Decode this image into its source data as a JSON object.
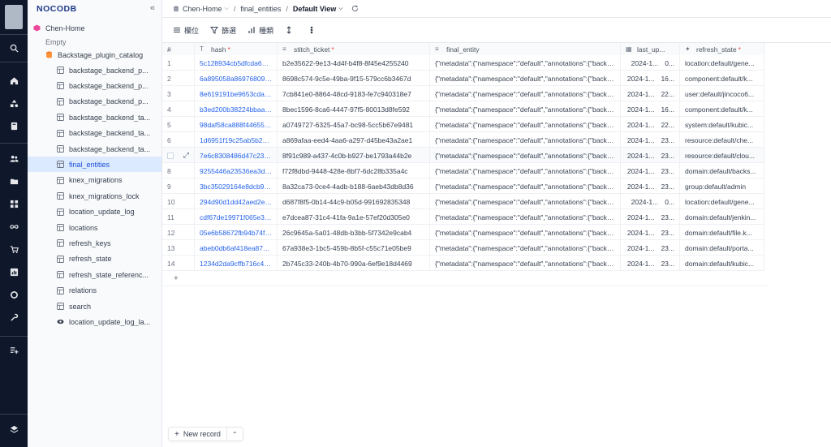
{
  "app": {
    "brand": "NOCODB",
    "collapse_glyph": "«"
  },
  "rail": {
    "icons": [
      "search-icon",
      "home-icon",
      "shapes-icon",
      "book-icon",
      "users-icon",
      "folder-icon",
      "grid-icon",
      "infinity-icon",
      "cart-icon",
      "chart-icon",
      "settings-icon",
      "wrench-icon",
      "list-plus-icon",
      "layers-icon"
    ]
  },
  "sidebar": {
    "project": "Chen-Home",
    "empty_label": "Empty",
    "base": "Backstage_plugin_catalog",
    "tables": [
      {
        "label": "backstage_backend_p..."
      },
      {
        "label": "backstage_backend_p..."
      },
      {
        "label": "backstage_backend_p..."
      },
      {
        "label": "backstage_backend_ta..."
      },
      {
        "label": "backstage_backend_ta..."
      },
      {
        "label": "backstage_backend_ta..."
      },
      {
        "label": "final_entities",
        "active": true
      },
      {
        "label": "knex_migrations"
      },
      {
        "label": "knex_migrations_lock"
      },
      {
        "label": "location_update_log"
      },
      {
        "label": "locations"
      },
      {
        "label": "refresh_keys"
      },
      {
        "label": "refresh_state"
      },
      {
        "label": "refresh_state_referenc..."
      },
      {
        "label": "relations"
      },
      {
        "label": "search"
      },
      {
        "label": "location_update_log_la...",
        "view": true
      }
    ]
  },
  "topbar": {
    "project": "Chen-Home",
    "table": "final_entities",
    "view": "Default View"
  },
  "toolbar": {
    "fields": "欄位",
    "filter": "篩選",
    "group": "種類"
  },
  "grid": {
    "columns": [
      {
        "label": "#"
      },
      {
        "label": "hash",
        "icon": "T",
        "required": true
      },
      {
        "label": "stitch_ticket",
        "icon": "≡",
        "required": true
      },
      {
        "label": "final_entity",
        "icon": "≡",
        "required": false
      },
      {
        "label": "last_up...",
        "icon": "▦",
        "required": false
      },
      {
        "label": "refresh_state",
        "icon": "✦",
        "required": true
      }
    ],
    "rows": [
      {
        "n": "1",
        "hash": "5c128934cb5dfcda62e...",
        "ticket": "b2e35622-9e13-4d4f-b4f8-8f45e4255240",
        "entity": "{\"metadata\":{\"namespace\":\"default\",\"annotations\":{\"backst...",
        "date": "2024-1...",
        "time": "0...",
        "state": "location:default/gene..."
      },
      {
        "n": "2",
        "hash": "6a895058a86976809b...",
        "ticket": "8698c574-9c5e-49ba-9f15-579cc6b3467d",
        "entity": "{\"metadata\":{\"namespace\":\"default\",\"annotations\":{\"backst...",
        "date": "2024-1...",
        "time": "16...",
        "state": "component:default/k..."
      },
      {
        "n": "3",
        "hash": "8e619191be9653cda6...",
        "ticket": "7cb841e0-8864-48cd-9183-fe7c940318e7",
        "entity": "{\"metadata\":{\"namespace\":\"default\",\"annotations\":{\"backst...",
        "date": "2024-1...",
        "time": "22...",
        "state": "user:default/jincoco6..."
      },
      {
        "n": "4",
        "hash": "b3ed200b38224bbaa6...",
        "ticket": "8bec1596-8ca6-4447-97f5-80013d8fe592",
        "entity": "{\"metadata\":{\"namespace\":\"default\",\"annotations\":{\"backst...",
        "date": "2024-1...",
        "time": "16...",
        "state": "component:default/k..."
      },
      {
        "n": "5",
        "hash": "98daf58ca888f446553...",
        "ticket": "a0749727-6325-45a7-bc98-5cc5b67e9481",
        "entity": "{\"metadata\":{\"namespace\":\"default\",\"annotations\":{\"backst...",
        "date": "2024-1...",
        "time": "22...",
        "state": "system:default/kubic..."
      },
      {
        "n": "6",
        "hash": "1d6951f19c25ab5b26...",
        "ticket": "a869afaa-eed4-4aa6-a297-d45be43a2ae1",
        "entity": "{\"metadata\":{\"namespace\":\"default\",\"annotations\":{\"backst...",
        "date": "2024-1...",
        "time": "23...",
        "state": "resource:default/che..."
      },
      {
        "n": "7",
        "hash": "7e6c8308486d47c230...",
        "ticket": "8f91c989-a437-4c0b-b927-be1793a44b2e",
        "entity": "{\"metadata\":{\"namespace\":\"default\",\"annotations\":{\"backst...",
        "date": "2024-1...",
        "time": "23...",
        "state": "resource:default/clou...",
        "hover": true
      },
      {
        "n": "8",
        "hash": "9255446a23536ea3dd...",
        "ticket": "f72f8dbd-9448-428e-8bf7-6dc28b335a4c",
        "entity": "{\"metadata\":{\"namespace\":\"default\",\"annotations\":{\"backst...",
        "date": "2024-1...",
        "time": "23...",
        "state": "domain:default/backs..."
      },
      {
        "n": "9",
        "hash": "3bc35029164e8dcb9d...",
        "ticket": "8a32ca73-0ce4-4adb-b188-6aeb43db8d36",
        "entity": "{\"metadata\":{\"namespace\":\"default\",\"annotations\":{\"backst...",
        "date": "2024-1...",
        "time": "23...",
        "state": "group:default/admin"
      },
      {
        "n": "10",
        "hash": "294d90d1dd42aed2e5...",
        "ticket": "d687f8f5-0b14-44c9-b05d-991692835348",
        "entity": "{\"metadata\":{\"namespace\":\"default\",\"annotations\":{\"backst...",
        "date": "2024-1...",
        "time": "0...",
        "state": "location:default/gene..."
      },
      {
        "n": "11",
        "hash": "cdf67de19971f065e31...",
        "ticket": "e7dcea87-31c4-41fa-9a1e-57ef20d305e0",
        "entity": "{\"metadata\":{\"namespace\":\"default\",\"annotations\":{\"backst...",
        "date": "2024-1...",
        "time": "23...",
        "state": "domain:default/jenkin..."
      },
      {
        "n": "12",
        "hash": "05e6b58672fb94b74fd...",
        "ticket": "26c9645a-5a01-48db-b3bb-5f7342e9cab4",
        "entity": "{\"metadata\":{\"namespace\":\"default\",\"annotations\":{\"backst...",
        "date": "2024-1...",
        "time": "23...",
        "state": "domain:default/file.k..."
      },
      {
        "n": "13",
        "hash": "abeb0db6af418ea878...",
        "ticket": "67a938e3-1bc5-459b-8b5f-c55c71e05be9",
        "entity": "{\"metadata\":{\"namespace\":\"default\",\"annotations\":{\"backst...",
        "date": "2024-1...",
        "time": "23...",
        "state": "domain:default/porta..."
      },
      {
        "n": "14",
        "hash": "1234d2da9cffb716c4e...",
        "ticket": "2b745c33-240b-4b70-990a-6ef9e18d4469",
        "entity": "{\"metadata\":{\"namespace\":\"default\",\"annotations\":{\"backst...",
        "date": "2024-1...",
        "time": "23...",
        "state": "domain:default/kubic..."
      }
    ],
    "add_row_glyph": "+"
  },
  "footer": {
    "new_record": "New record"
  }
}
